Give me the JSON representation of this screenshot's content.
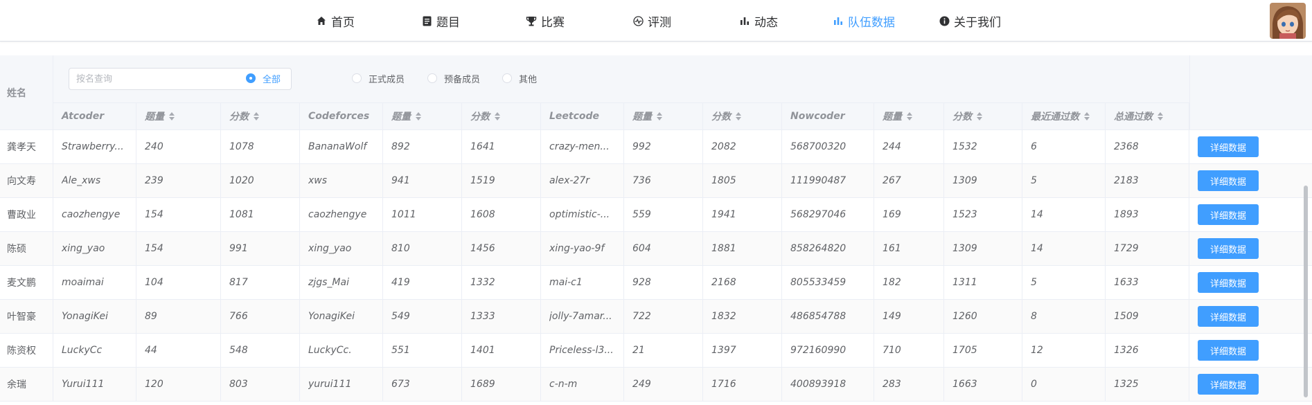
{
  "nav": {
    "items": [
      {
        "label": "首页",
        "icon": "home-icon"
      },
      {
        "label": "题目",
        "icon": "document-icon"
      },
      {
        "label": "比赛",
        "icon": "trophy-icon"
      },
      {
        "label": "评测",
        "icon": "pulse-icon"
      },
      {
        "label": "动态",
        "icon": "bar-chart-icon"
      },
      {
        "label": "队伍数据",
        "icon": "bar-chart-icon",
        "active": true
      },
      {
        "label": "关于我们",
        "icon": "info-icon"
      }
    ],
    "active_color": "#409eff"
  },
  "filters": {
    "search_placeholder": "按名查询",
    "radios": [
      {
        "label": "全部",
        "checked": true
      },
      {
        "label": "正式成员",
        "checked": false
      },
      {
        "label": "预备成员",
        "checked": false
      },
      {
        "label": "其他",
        "checked": false
      }
    ]
  },
  "table": {
    "name_header": "姓名",
    "headers": [
      "Atcoder",
      "题量",
      "分数",
      "Codeforces",
      "题量",
      "分数",
      "Leetcode",
      "题量",
      "分数",
      "Nowcoder",
      "题量",
      "分数",
      "最近通过数",
      "总通过数"
    ],
    "detail_label": "详细数据",
    "rows": [
      [
        "龚孝天",
        "Strawberry...",
        "240",
        "1078",
        "BananaWolf",
        "892",
        "1641",
        "crazy-men...",
        "992",
        "2082",
        "568700320",
        "244",
        "1532",
        "6",
        "2368"
      ],
      [
        "向文寿",
        "Ale_xws",
        "239",
        "1020",
        "xws",
        "941",
        "1519",
        "alex-27r",
        "736",
        "1805",
        "111990487",
        "267",
        "1309",
        "5",
        "2183"
      ],
      [
        "曹政业",
        "caozhengye",
        "154",
        "1081",
        "caozhengye",
        "1011",
        "1608",
        "optimistic-...",
        "559",
        "1941",
        "568297046",
        "169",
        "1523",
        "14",
        "1893"
      ],
      [
        "陈硕",
        "xing_yao",
        "154",
        "991",
        "xing_yao",
        "810",
        "1456",
        "xing-yao-9f",
        "604",
        "1881",
        "858264820",
        "161",
        "1309",
        "14",
        "1729"
      ],
      [
        "麦文鹏",
        "moaimai",
        "104",
        "817",
        "zjgs_Mai",
        "419",
        "1332",
        "mai-c1",
        "928",
        "2168",
        "805533459",
        "182",
        "1311",
        "5",
        "1633"
      ],
      [
        "叶智豪",
        "YonagiKei",
        "89",
        "766",
        "YonagiKei",
        "549",
        "1333",
        "jolly-7amar...",
        "722",
        "1832",
        "486854788",
        "149",
        "1260",
        "8",
        "1509"
      ],
      [
        "陈资权",
        "LuckyCc",
        "44",
        "548",
        "LuckyCc.",
        "551",
        "1401",
        "Priceless-l3...",
        "21",
        "1397",
        "972160990",
        "710",
        "1705",
        "12",
        "1326"
      ],
      [
        "余瑞",
        "Yurui111",
        "120",
        "803",
        "yurui111",
        "673",
        "1689",
        "c-n-m",
        "249",
        "1716",
        "400893918",
        "283",
        "1663",
        "0",
        "1325"
      ]
    ]
  }
}
